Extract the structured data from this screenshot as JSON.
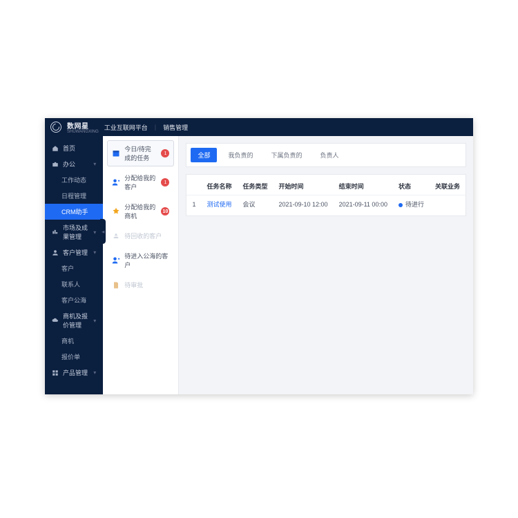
{
  "header": {
    "brand": "数网星",
    "brand_sub": "SHUWANGXING",
    "platform": "工业互联网平台",
    "section": "销售管理"
  },
  "sidebar": {
    "items": [
      {
        "label": "首页"
      },
      {
        "label": "办公",
        "children": [
          "工作动态",
          "日程管理",
          "CRM助手"
        ]
      },
      {
        "label": "市场及成果管理"
      },
      {
        "label": "客户管理",
        "children": [
          "客户",
          "联系人",
          "客户公海"
        ]
      },
      {
        "label": "商机及报价管理",
        "children": [
          "商机",
          "报价单"
        ]
      },
      {
        "label": "产品管理"
      }
    ]
  },
  "secondary": {
    "items": [
      {
        "label": "今日/待完成的任务",
        "badge": "1"
      },
      {
        "label": "分配给我的客户",
        "badge": "1"
      },
      {
        "label": "分配给我的商机",
        "badge": "10"
      },
      {
        "label": "待回收的客户"
      },
      {
        "label": "待进入公海的客户"
      },
      {
        "label": "待审批"
      }
    ]
  },
  "tabs": [
    "全部",
    "我负责的",
    "下属负责的",
    "负责人"
  ],
  "table": {
    "columns": [
      "任务名称",
      "任务类型",
      "开始时间",
      "结束时间",
      "状态",
      "关联业务"
    ],
    "rows": [
      {
        "index": "1",
        "name": "测试使用",
        "type": "会议",
        "start": "2021-09-10 12:00",
        "end": "2021-09-11 00:00",
        "status": "待进行",
        "related": ""
      }
    ]
  }
}
